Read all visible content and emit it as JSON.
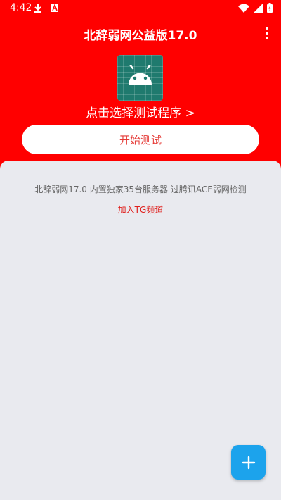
{
  "status_bar": {
    "time": "4:42",
    "left_icons": [
      "download-icon",
      "a-icon"
    ],
    "right_icons": [
      "wifi-icon",
      "signal-icon",
      "battery-icon"
    ]
  },
  "app_bar": {
    "title": "北辞弱网公益版17.0",
    "menu_icon": "more-vert-icon"
  },
  "header": {
    "app_icon": "android-icon",
    "select_program_label": "点击选择测试程序 >",
    "start_button_label": "开始测试"
  },
  "content": {
    "info_text": "北辞弱网17.0 内置独家35台服务器 过腾讯ACE弱网检测",
    "tg_link_label": "加入TG频道"
  },
  "fab": {
    "icon": "plus-icon"
  },
  "colors": {
    "primary": "#ff0000",
    "sheet_background": "#e9eaef",
    "fab": "#1ca3ec",
    "link": "#e0201d"
  }
}
